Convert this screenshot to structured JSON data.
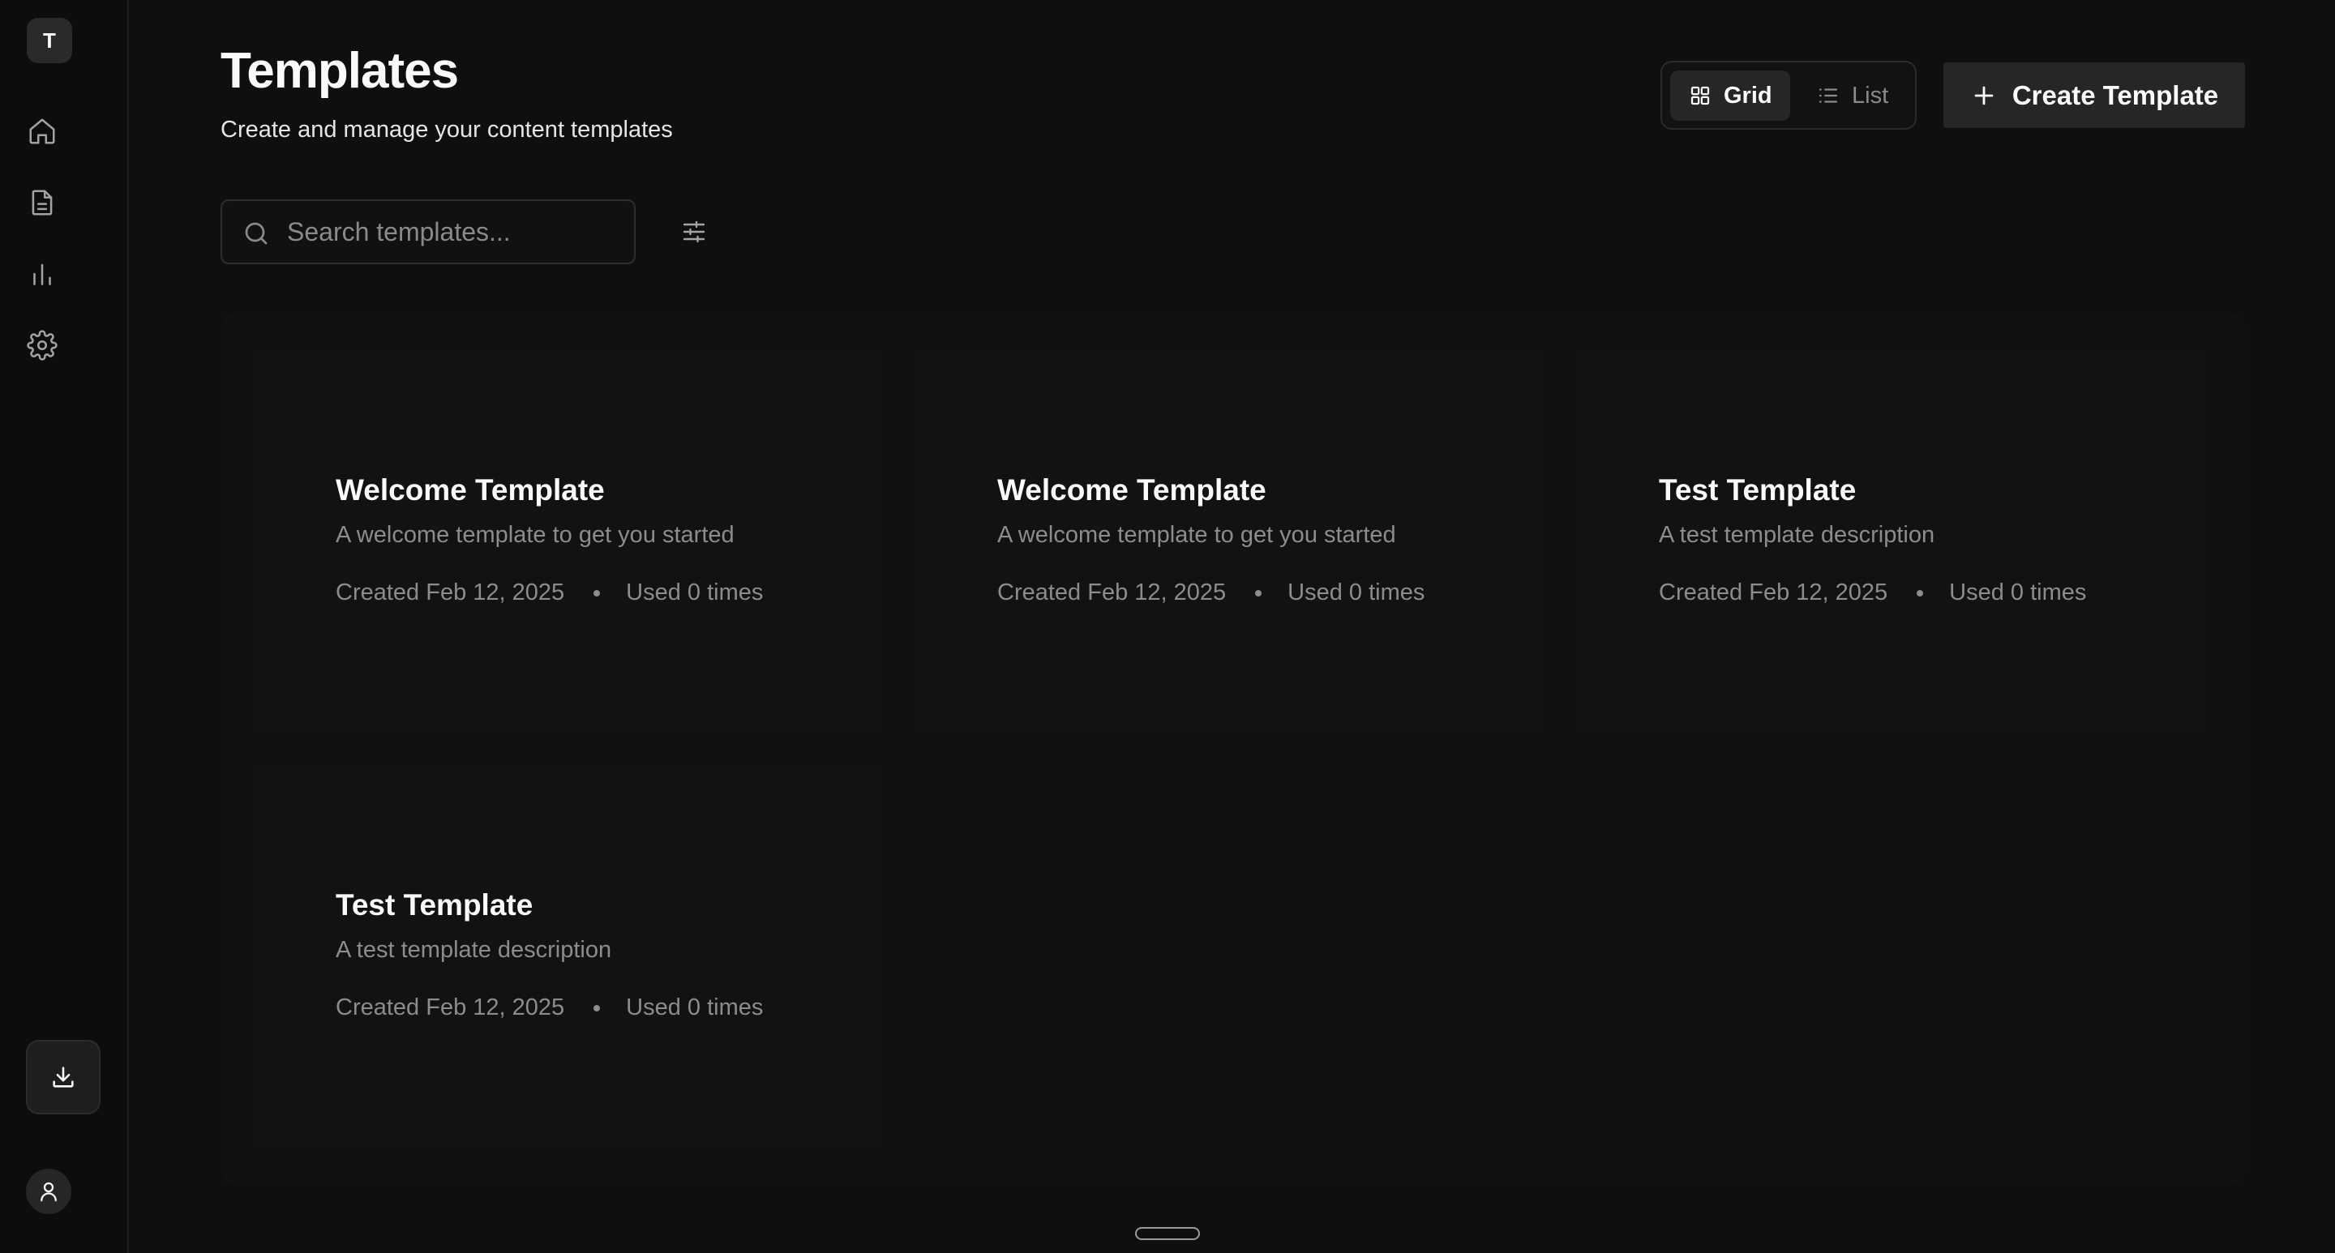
{
  "sidebar": {
    "logo_letter": "T",
    "items": [
      {
        "icon": "home-icon"
      },
      {
        "icon": "document-icon"
      },
      {
        "icon": "bar-chart-icon"
      },
      {
        "icon": "gear-icon"
      }
    ],
    "download_icon": "download-icon",
    "avatar_icon": "user-icon"
  },
  "header": {
    "title": "Templates",
    "subtitle": "Create and manage your content templates"
  },
  "view_toggle": {
    "grid_label": "Grid",
    "list_label": "List",
    "selected": "Grid"
  },
  "create_button": {
    "label": "Create Template"
  },
  "search": {
    "placeholder": "Search templates...",
    "value": ""
  },
  "templates": [
    {
      "title": "Welcome Template",
      "description": "A welcome template to get you started",
      "created": "Created Feb 12, 2025",
      "used": "Used 0 times"
    },
    {
      "title": "Welcome Template",
      "description": "A welcome template to get you started",
      "created": "Created Feb 12, 2025",
      "used": "Used 0 times"
    },
    {
      "title": "Test Template",
      "description": "A test template description",
      "created": "Created Feb 12, 2025",
      "used": "Used 0 times"
    },
    {
      "title": "Test Template",
      "description": "A test template description",
      "created": "Created Feb 12, 2025",
      "used": "Used 0 times"
    }
  ],
  "colors": {
    "background": "#0f0f0f",
    "sidebar": "#0d0d0d",
    "card": "#121212",
    "button": "#262626",
    "text_primary": "#fafafa",
    "text_muted": "#8c8c8c"
  }
}
